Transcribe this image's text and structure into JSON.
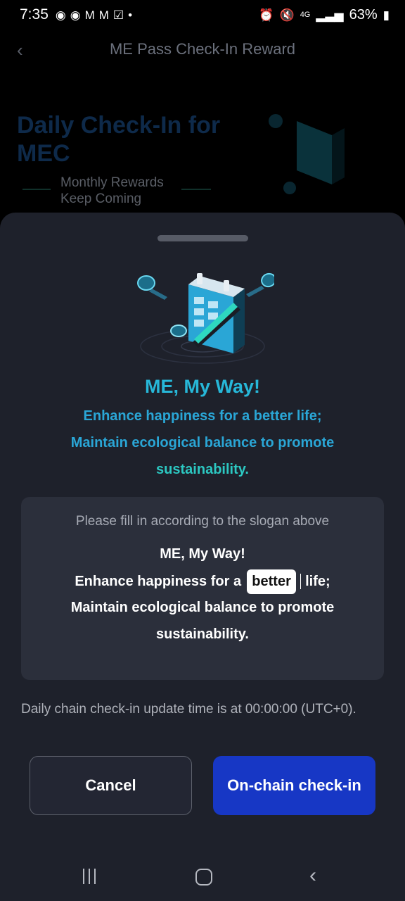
{
  "status_bar": {
    "time": "7:35",
    "notifications": [
      "messenger-icon",
      "messenger-icon",
      "gmail-icon",
      "gmail-icon",
      "check-icon",
      "dot-icon"
    ],
    "network": "4G",
    "battery": "63%"
  },
  "background_page": {
    "title": "ME Pass Check-In Reward",
    "hero_title": "Daily Check-In for MEC",
    "hero_subtitle_line1": "Monthly Rewards",
    "hero_subtitle_line2": "Keep Coming"
  },
  "sheet": {
    "slogan": {
      "title": "ME, My Way!",
      "line1": "Enhance happiness for a better life;",
      "line2": "Maintain ecological balance to promote",
      "line3": "sustainability."
    },
    "fill": {
      "prompt": "Please fill in according to the slogan above",
      "line1": "ME, My Way!",
      "line2_before": "Enhance happiness for a",
      "blank_value": "better",
      "line2_after": "life;",
      "line3": "Maintain ecological balance to promote",
      "line4": "sustainability."
    },
    "update_note": "Daily chain check-in update time is at 00:00:00 (UTC+0).",
    "cancel_label": "Cancel",
    "checkin_label": "On-chain check-in"
  },
  "colors": {
    "sheet_bg": "#1e212b",
    "card_bg": "#2b2f3b",
    "primary_button": "#1737c5",
    "slogan_accent": "#27b7d8"
  }
}
